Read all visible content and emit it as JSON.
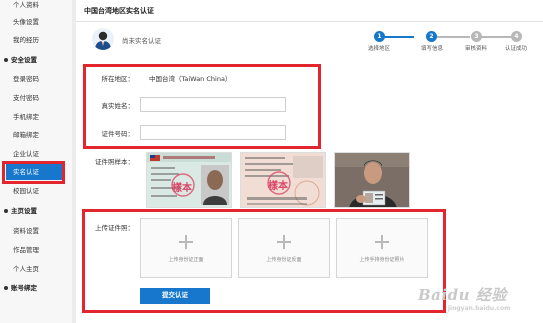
{
  "sidebar": {
    "items": [
      {
        "label": "个人资料",
        "kind": "item"
      },
      {
        "label": "头像设置",
        "kind": "item"
      },
      {
        "label": "我的经历",
        "kind": "item"
      },
      {
        "label": "安全设置",
        "kind": "section"
      },
      {
        "label": "登录密码",
        "kind": "item"
      },
      {
        "label": "支付密码",
        "kind": "item"
      },
      {
        "label": "手机绑定",
        "kind": "item"
      },
      {
        "label": "邮箱绑定",
        "kind": "item"
      },
      {
        "label": "企业认证",
        "kind": "item"
      },
      {
        "label": "实名认证",
        "kind": "active"
      },
      {
        "label": "校园认证",
        "kind": "item"
      },
      {
        "label": "主页设置",
        "kind": "section"
      },
      {
        "label": "资料设置",
        "kind": "item"
      },
      {
        "label": "作品管理",
        "kind": "item"
      },
      {
        "label": "个人主页",
        "kind": "item"
      },
      {
        "label": "账号绑定",
        "kind": "section"
      }
    ]
  },
  "page": {
    "title": "中国台湾地区实名认证",
    "status": "尚未实名认证"
  },
  "steps": [
    {
      "num": "1",
      "label": "选择地区",
      "state": "done"
    },
    {
      "num": "2",
      "label": "填写信息",
      "state": "current"
    },
    {
      "num": "3",
      "label": "审核资料",
      "state": "todo"
    },
    {
      "num": "4",
      "label": "认证成功",
      "state": "todo"
    }
  ],
  "form": {
    "region_label": "所在地区：",
    "region_value": "中国台湾（TaiWan China）",
    "name_label": "真实姓名：",
    "name_value": "",
    "id_label": "证件号码：",
    "id_value": "",
    "sample_label": "证件照样本：",
    "upload_label": "上传证件照：",
    "uploads": [
      "上传身份证正面",
      "上传身份证反面",
      "上传手持身份证照片"
    ],
    "submit_label": "提交认证"
  },
  "samples": {
    "front_stamp": "樣本",
    "back_stamp": "樣本"
  },
  "watermark": {
    "main": "Baidu 经验",
    "sub": "jingyan.baidu.com"
  },
  "colors": {
    "accent": "#1677cc",
    "highlight": "#e3262d",
    "step_todo": "#b8b8b8"
  }
}
